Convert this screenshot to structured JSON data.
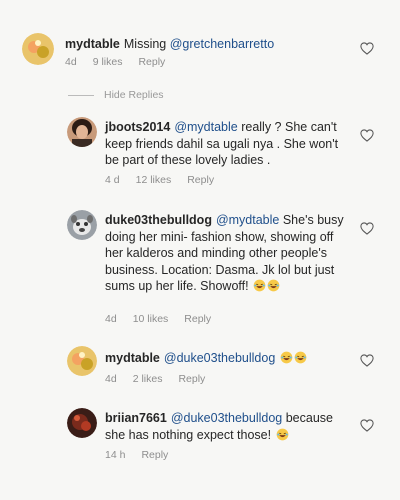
{
  "comments": [
    {
      "username": "mydtable",
      "parts": [
        "Missing ",
        "@gretchenbarretto"
      ],
      "age": "4d",
      "likes": "9 likes",
      "reply": "Reply"
    },
    {
      "username": "jboots2014",
      "mention": "@mydtable",
      "text": " really ? She can't keep friends dahil sa ugali nya . She won't be part of these lovely ladies .",
      "age": "4 d",
      "likes": "12 likes",
      "reply": "Reply"
    },
    {
      "username": "duke03thebulldog",
      "mention": "@mydtable",
      "text": " She's busy doing her mini- fashion show, showing off her kalderos and minding other people's business. Location: Dasma. Jk lol but just sums up her life. Showoff! ",
      "age": "4d",
      "likes": "10 likes",
      "reply": "Reply"
    },
    {
      "username": "mydtable",
      "mention": "@duke03thebulldog",
      "text": " ",
      "age": "4d",
      "likes": "2 likes",
      "reply": "Reply"
    },
    {
      "username": "briian7661",
      "mention": "@duke03thebulldog",
      "text": " because she has nothing expect those! ",
      "age": "14 h",
      "reply": "Reply"
    }
  ],
  "hide_replies": "Hide Replies",
  "icons": {
    "heart": "heart-outline-icon",
    "emoji": "laughing-emoji-icon"
  },
  "colors": {
    "mention": "#1f4f8b",
    "meta": "#8e8e8e"
  }
}
